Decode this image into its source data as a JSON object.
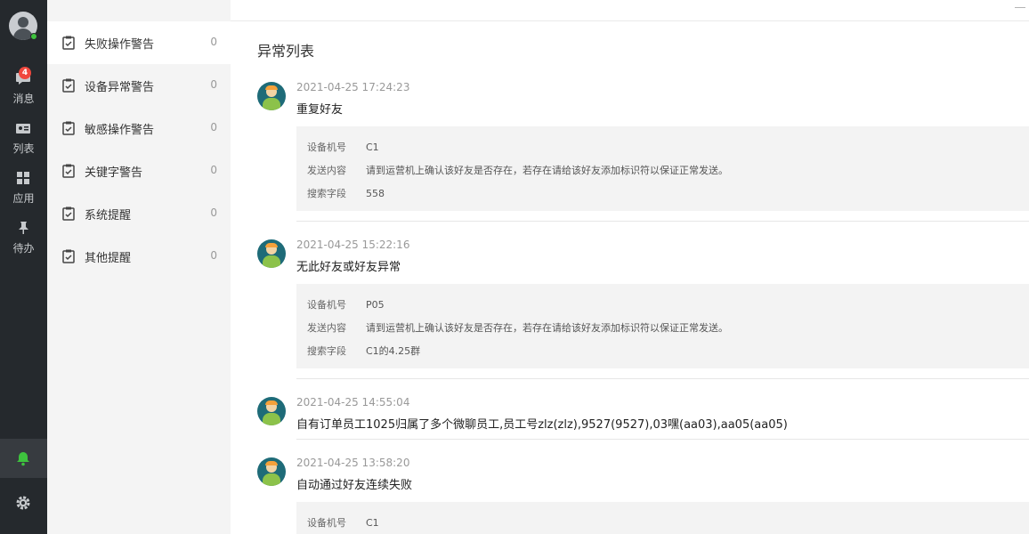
{
  "rail": {
    "items": [
      {
        "label": "消息",
        "icon": "message-icon",
        "badge": "4"
      },
      {
        "label": "列表",
        "icon": "contact-card-icon"
      },
      {
        "label": "应用",
        "icon": "apps-grid-icon"
      },
      {
        "label": "待办",
        "icon": "pin-icon"
      }
    ],
    "bell_icon": "bell-icon",
    "settings_icon": "gear-icon",
    "accent_green": "#3ec23e",
    "badge_color": "#f0483e"
  },
  "categories": [
    {
      "name": "失败操作警告",
      "count": "0",
      "active": true
    },
    {
      "name": "设备异常警告",
      "count": "0"
    },
    {
      "name": "敏感操作警告",
      "count": "0"
    },
    {
      "name": "关键字警告",
      "count": "0"
    },
    {
      "name": "系统提醒",
      "count": "0"
    },
    {
      "name": "其他提醒",
      "count": "0"
    }
  ],
  "main": {
    "title": "异常列表",
    "entries": [
      {
        "time": "2021-04-25 17:24:23",
        "title": "重复好友",
        "details": [
          {
            "key": "设备机号",
            "value": "C1"
          },
          {
            "key": "发送内容",
            "value": "请到运营机上确认该好友是否存在，若存在请给该好友添加标识符以保证正常发送。"
          },
          {
            "key": "搜索字段",
            "value": "558"
          }
        ]
      },
      {
        "time": "2021-04-25 15:22:16",
        "title": "无此好友或好友异常",
        "details": [
          {
            "key": "设备机号",
            "value": "P05"
          },
          {
            "key": "发送内容",
            "value": "请到运营机上确认该好友是否存在，若存在请给该好友添加标识符以保证正常发送。"
          },
          {
            "key": "搜索字段",
            "value": "C1的4.25群"
          }
        ]
      },
      {
        "time": "2021-04-25 14:55:04",
        "title": "自有订单员工1025归属了多个微聊员工,员工号zlz(zlz),9527(9527),03嘿(aa03),aa05(aa05)"
      },
      {
        "time": "2021-04-25 13:58:20",
        "title": "自动通过好友连续失败",
        "details": [
          {
            "key": "设备机号",
            "value": "C1"
          }
        ]
      }
    ]
  }
}
